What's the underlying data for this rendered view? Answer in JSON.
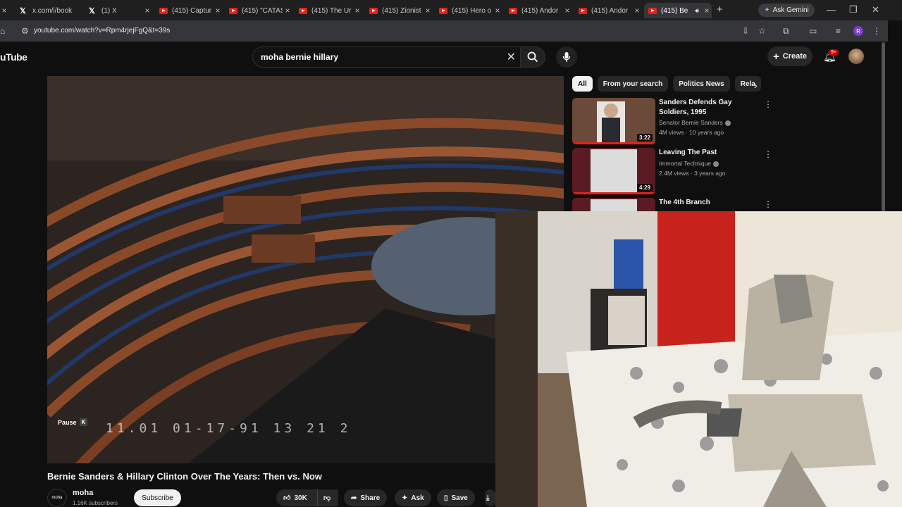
{
  "browser": {
    "tabs": [
      {
        "label": "x.com/i/book",
        "icon": "x-icon"
      },
      {
        "label": "(1) X",
        "icon": "x-icon"
      },
      {
        "label": "(415) Captur",
        "icon": "youtube-icon"
      },
      {
        "label": "(415) \"CATAS",
        "icon": "youtube-icon"
      },
      {
        "label": "(415) The Ur",
        "icon": "youtube-icon"
      },
      {
        "label": "(415) Zionist",
        "icon": "youtube-icon"
      },
      {
        "label": "(415) Hero o",
        "icon": "youtube-icon"
      },
      {
        "label": "(415) Andor",
        "icon": "youtube-icon"
      },
      {
        "label": "(415) Andor",
        "icon": "youtube-icon"
      },
      {
        "label": "(415) Be",
        "icon": "youtube-icon"
      }
    ],
    "ask_gemini": "Ask Gemini",
    "url": "youtube.com/watch?v=Rpm4rjejFgQ&t=39s",
    "profile_initial": "R"
  },
  "youtube": {
    "logo_text": "uTube",
    "search_query": "moha bernie hillary",
    "create_label": "Create",
    "notifications_badge": "9+"
  },
  "player": {
    "pause_label": "Pause",
    "pause_key": "K",
    "video_timestamp": "11.01   01-17-91   13 21 2"
  },
  "sidebar": {
    "chips": [
      "All",
      "From your search",
      "Politics News",
      "Rela"
    ],
    "recommendations": [
      {
        "title": "Sanders Defends Gay Soldiers, 1995",
        "channel": "Senator Bernie Sanders",
        "meta": "4M views · 10 years ago",
        "duration": "3:22"
      },
      {
        "title": "Leaving The Past",
        "channel": "Immortal Technique",
        "meta": "2.4M views · 3 years ago",
        "duration": "4:29"
      },
      {
        "title": "The 4th Branch",
        "channel": "",
        "meta": "",
        "duration": ""
      }
    ]
  },
  "video_info": {
    "title": "Bernie Sanders & Hillary Clinton Over The Years: Then vs. Now",
    "channel": "moha",
    "channel_avatar_text": "moha",
    "subscribers": "1.16K subscribers",
    "subscribe_label": "Subscribe",
    "likes": "30K",
    "share_label": "Share",
    "ask_label": "Ask",
    "save_label": "Save"
  },
  "colors": {
    "accent_red": "#cc0000",
    "background": "#0f0f0f"
  }
}
